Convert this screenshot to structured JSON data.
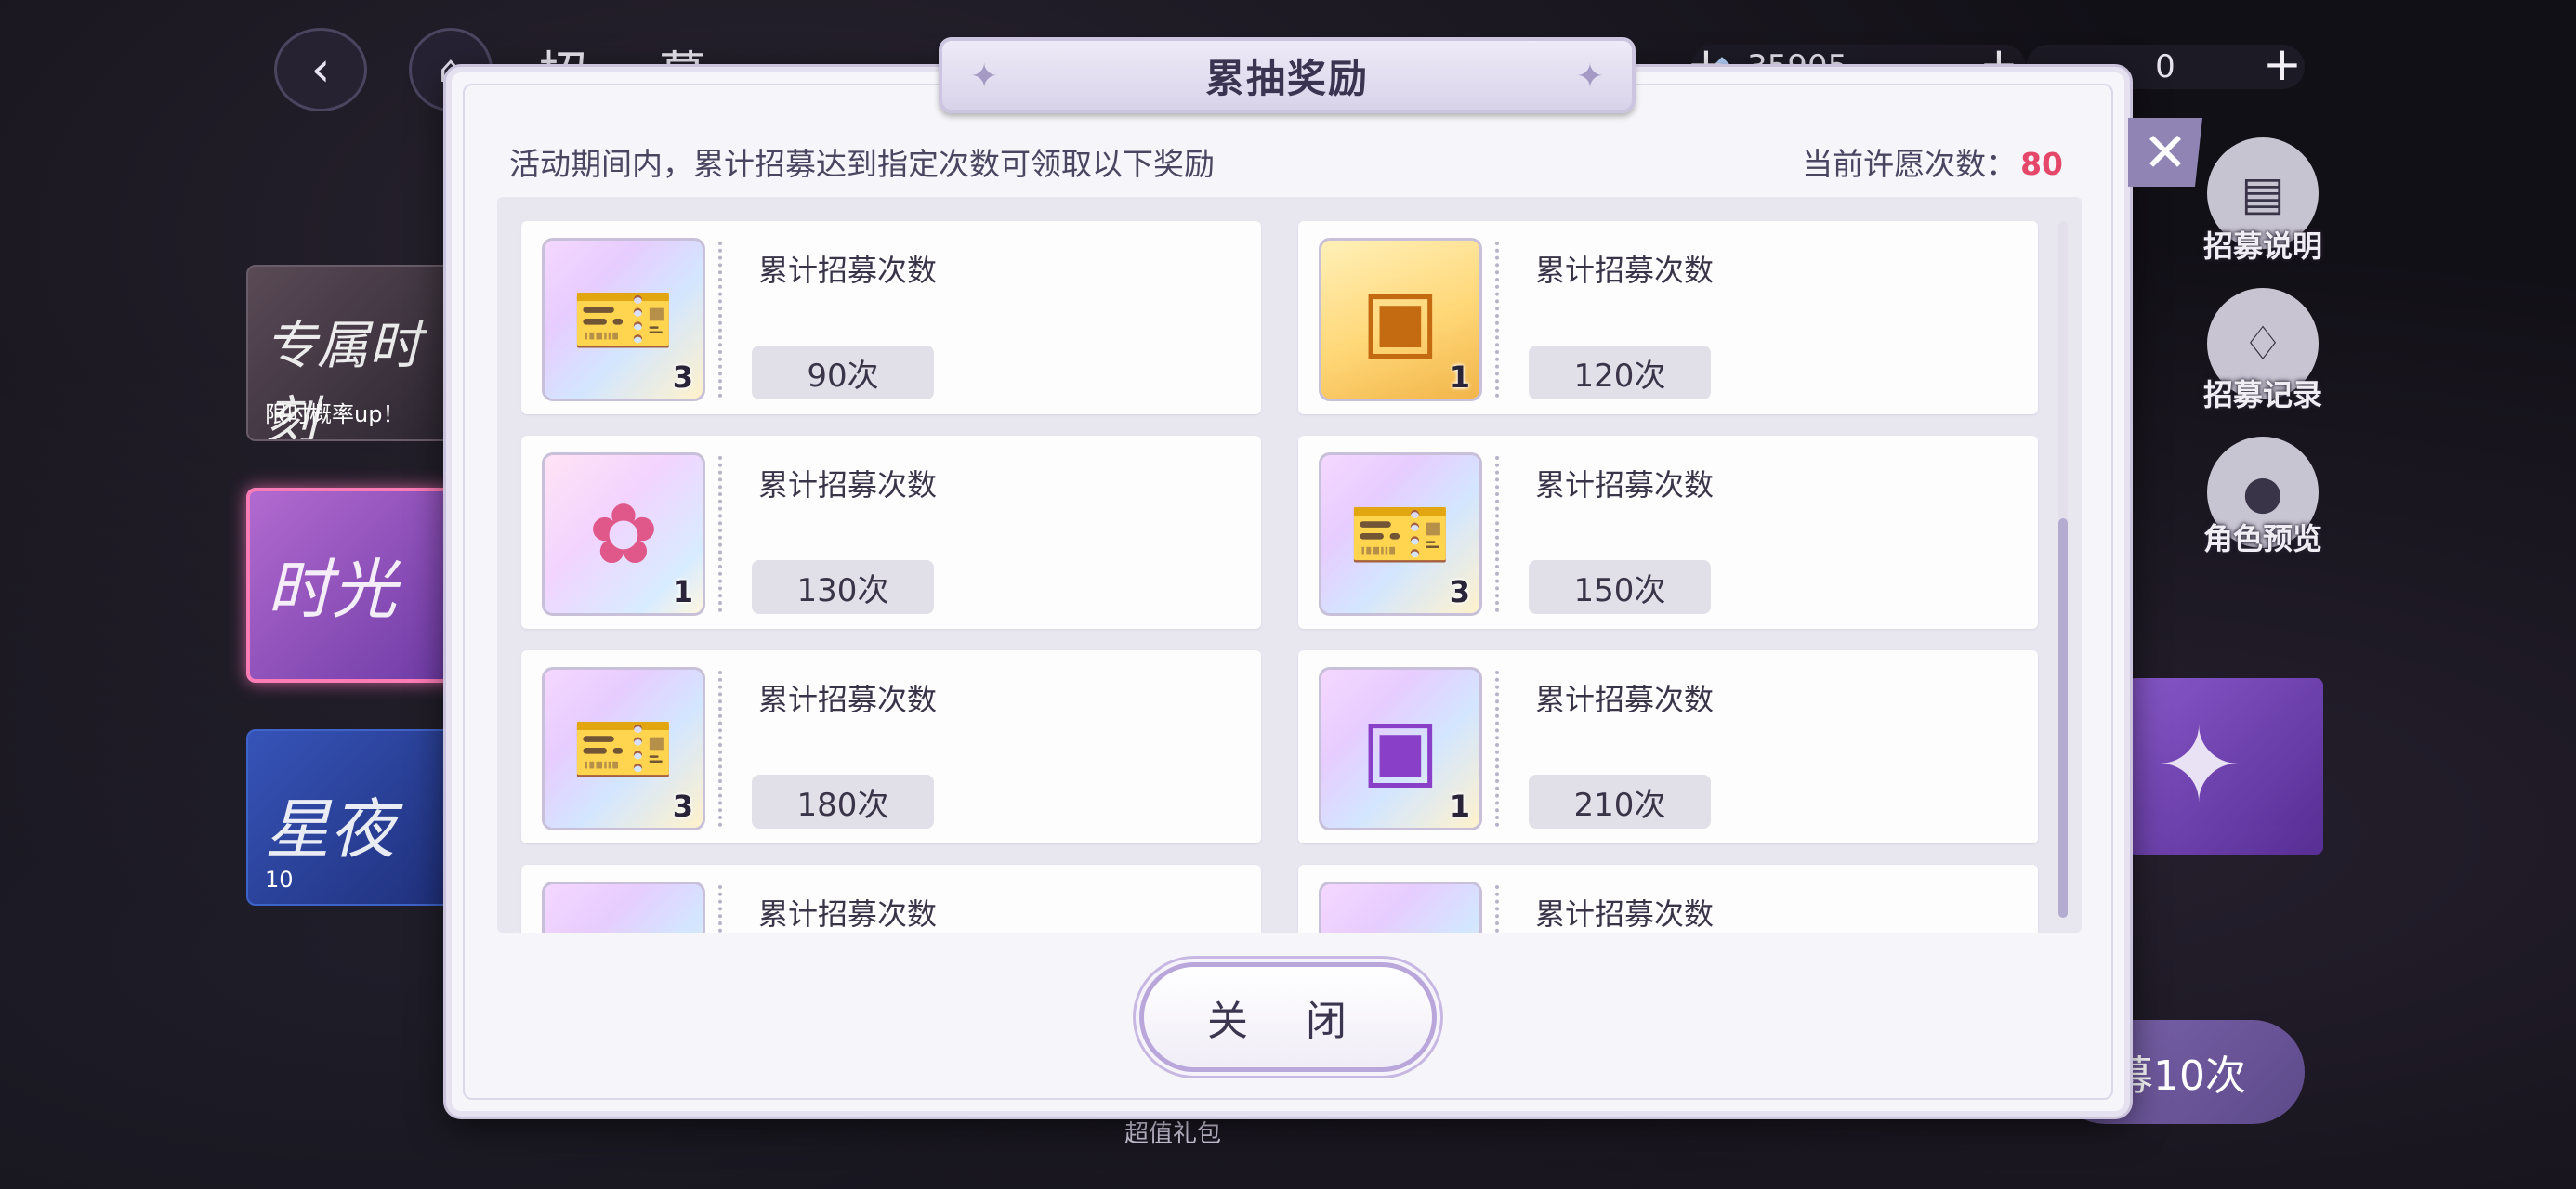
{
  "header": {
    "back_icon": "back-arrow-icon",
    "home_icon": "home-icon",
    "title": "招 募",
    "gem_count": "35905",
    "ticket_count": "0"
  },
  "banners": [
    {
      "text": "专属时刻",
      "sub": "限时概率up！"
    },
    {
      "text": "时光",
      "sub": ""
    },
    {
      "text": "星夜",
      "sub": "10"
    }
  ],
  "side_menu": [
    {
      "label": "招募说明",
      "icon": "clipboard-icon"
    },
    {
      "label": "招募记录",
      "icon": "cards-icon"
    },
    {
      "label": "角色预览",
      "icon": "person-icon"
    }
  ],
  "recruit_button": {
    "label": "募10次",
    "cost": "x10"
  },
  "gift_label": "超值礼包",
  "modal": {
    "title": "累抽奖励",
    "description": "活动期间内，累计招募达到指定次数可领取以下奖励",
    "count_label": "当前许愿次数：",
    "count_value": "80",
    "close_label": "关 闭",
    "colors": {
      "accent": "#e5476b",
      "frame": "#cbc3dc"
    },
    "rewards": [
      {
        "label": "累计招募次数",
        "threshold": "90次",
        "qty": "3",
        "kind": "ticket",
        "icon": "ticket-icon"
      },
      {
        "label": "累计招募次数",
        "threshold": "120次",
        "qty": "1",
        "kind": "gold",
        "icon": "ssr-chest-icon"
      },
      {
        "label": "累计招募次数",
        "threshold": "130次",
        "qty": "1",
        "kind": "flower",
        "icon": "flower-chest-icon"
      },
      {
        "label": "累计招募次数",
        "threshold": "150次",
        "qty": "3",
        "kind": "ticket",
        "icon": "ticket-icon"
      },
      {
        "label": "累计招募次数",
        "threshold": "180次",
        "qty": "3",
        "kind": "ticket",
        "icon": "ticket-icon"
      },
      {
        "label": "累计招募次数",
        "threshold": "210次",
        "qty": "1",
        "kind": "ticket",
        "icon": "ur-chest-icon"
      },
      {
        "label": "累计招募次数",
        "threshold": "",
        "qty": "",
        "kind": "ticket",
        "icon": "ticket-icon"
      },
      {
        "label": "累计招募次数",
        "threshold": "",
        "qty": "",
        "kind": "ticket",
        "icon": "ticket-icon"
      }
    ]
  }
}
